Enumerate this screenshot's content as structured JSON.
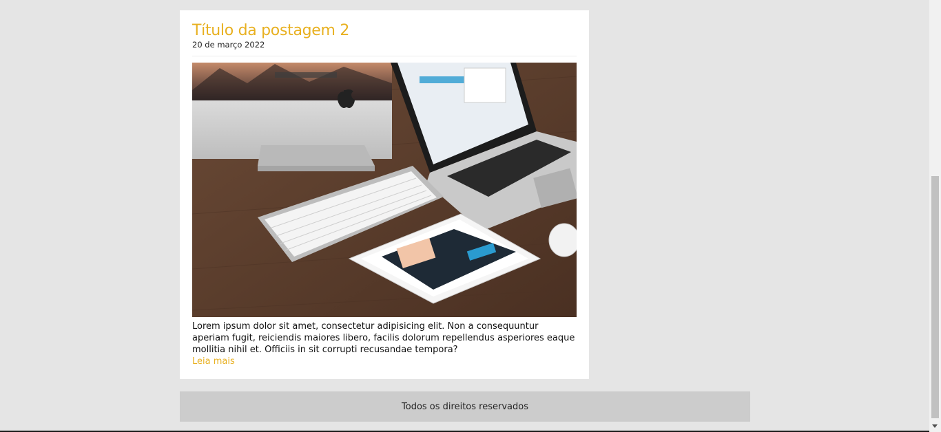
{
  "post": {
    "title": "Título da postagem 2",
    "date": "20 de março 2022",
    "excerpt": "Lorem ipsum dolor sit amet, consectetur adipisicing elit. Non a consequuntur aperiam fugit, reiciendis maiores libero, facilis dolorum repellendus asperiores eaque mollitia nihil et. Officiis in sit corrupti recusandae tempora?",
    "read_more": "Leia mais",
    "image_icon": "desk-with-imac-macbook-ipad-photo"
  },
  "footer": {
    "text": "Todos os direitos reservados"
  },
  "colors": {
    "accent": "#e8b020",
    "page_background": "#e5e5e5",
    "card_background": "#ffffff",
    "footer_background": "#cccccc"
  }
}
